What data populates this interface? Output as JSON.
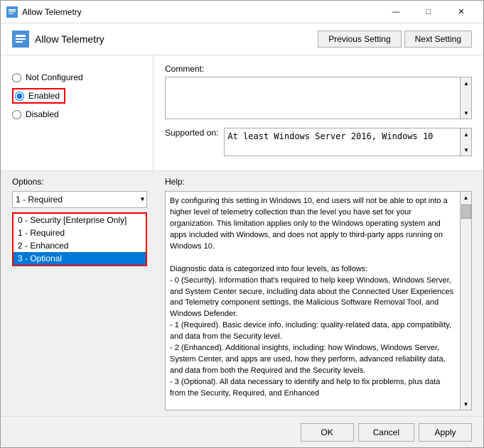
{
  "window": {
    "title": "Allow Telemetry",
    "title_icon": "policy-icon"
  },
  "header": {
    "title": "Allow Telemetry",
    "prev_button": "Previous Setting",
    "next_button": "Next Setting"
  },
  "comment": {
    "label": "Comment:",
    "value": ""
  },
  "supported": {
    "label": "Supported on:",
    "value": "At least Windows Server 2016, Windows 10"
  },
  "radio": {
    "not_configured": "Not Configured",
    "enabled": "Enabled",
    "disabled": "Disabled",
    "selected": "enabled"
  },
  "options": {
    "label": "Options:",
    "dropdown_value": "1 - Required",
    "items": [
      {
        "value": "0",
        "label": "0 - Security [Enterprise Only]",
        "selected": false
      },
      {
        "value": "1",
        "label": "1 - Required",
        "selected": false
      },
      {
        "value": "2",
        "label": "2 - Enhanced",
        "selected": false
      },
      {
        "value": "3",
        "label": "3 - Optional",
        "selected": true
      }
    ]
  },
  "help": {
    "label": "Help:",
    "text": "By configuring this setting in Windows 10, end users will not be able to opt into a higher level of telemetry collection than the level you have set for your organization.  This limitation applies only to the Windows operating system and apps included with Windows, and does not apply to third-party apps running on Windows 10.\n\nDiagnostic data is categorized into four levels, as follows:\n - 0 (Security). Information that's required to help keep Windows, Windows Server, and System Center secure, including data about the Connected User Experiences and Telemetry component settings, the Malicious Software Removal Tool, and Windows Defender.\n - 1 (Required). Basic device info, including: quality-related data, app compatibility, and data from the Security level.\n - 2 (Enhanced). Additional insights, including: how Windows, Windows Server, System Center, and apps are used, how they perform, advanced reliability data, and data from both the Required and the Security levels.\n - 3 (Optional). All data necessary to identify and help to fix problems, plus data from the Security, Required, and Enhanced"
  },
  "footer": {
    "ok": "OK",
    "cancel": "Cancel",
    "apply": "Apply"
  },
  "titlebar": {
    "minimize": "—",
    "maximize": "□",
    "close": "✕"
  }
}
